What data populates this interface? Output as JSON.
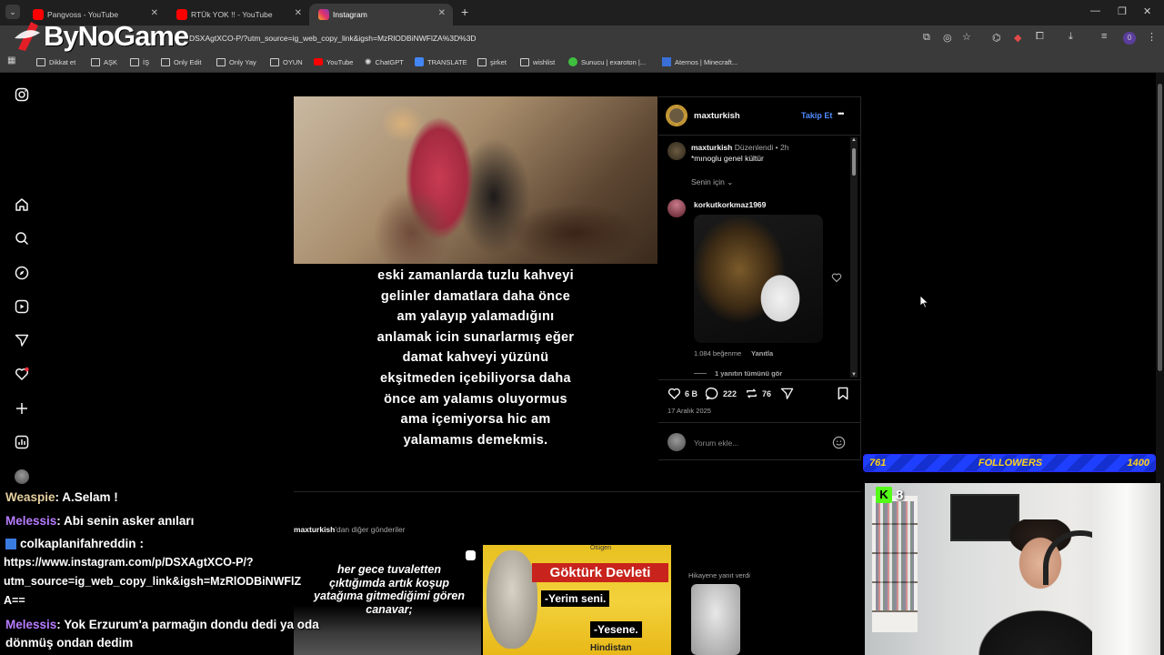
{
  "browser": {
    "tabs": [
      {
        "title": "Pangvoss - YouTube",
        "color": "#ff0000"
      },
      {
        "title": "RTÜk YOK !! - YouTube",
        "color": "#ff0000"
      },
      {
        "title": "Instagram",
        "color": "#e1306c"
      }
    ],
    "url": "DSXAgtXCO-P/?utm_source=ig_web_copy_link&igsh=MzRlODBiNWFlZA%3D%3D",
    "bookmarks": [
      "Dikkat et",
      "AŞK",
      "İŞ",
      "Only Edit",
      "Only Yay",
      "OYUN",
      "YouTube",
      "ChatGPT",
      "TRANSLATE",
      "şirket",
      "wishlist",
      "Sunucu | exaroton |...",
      "Aternos | Minecraft..."
    ],
    "profile_badge": "0"
  },
  "logo": {
    "text": "ByNoGame"
  },
  "post": {
    "caption_lines": [
      "eski zamanlarda tuzlu kahveyi",
      "gelinler damatlara daha önce",
      "am yalayıp yalamadığını",
      "anlamak icin sunarlarmış eğer",
      "damat kahveyi yüzünü",
      "ekşitmeden içebiliyorsa daha",
      "önce am yalamıs oluyormus",
      "ama içemiyorsa hic am",
      "yalamamıs demekmis."
    ],
    "author": "maxturkish",
    "follow_label": "Takip Et",
    "more_icon": "•••",
    "author_comment": {
      "user": "maxturkish",
      "edited": "Düzenlendi",
      "time": "2h",
      "text": "*mınoglu genel kültür"
    },
    "sort_label": "Senin için",
    "comment": {
      "user": "korkutkorkmaz1969",
      "likes": "1.084 beğenme",
      "reply": "Yanıtla",
      "view_replies": "1 yanıtın tümünü gör"
    },
    "stats": {
      "likes": "6 B",
      "comments": "222",
      "reposts": "76"
    },
    "date": "17 Aralık 2025",
    "comment_placeholder": "Yorum ekle..."
  },
  "more_posts": {
    "author": "maxturkish",
    "suffix": "'dan diğer gönderiler",
    "thumb1_text": "her gece tuvaletten çıktığımda artık koşup yatağıma gitmediğimi gören canavar;",
    "thumb2": {
      "title": "Göktürk Devleti",
      "line1": "-Yerim seni.",
      "line2": "-Yesene.",
      "top": "Otügen",
      "bottom": "Hindistan"
    },
    "story_reply": "Hikayene yanıt verdi"
  },
  "overlay": {
    "followers_current": "761",
    "followers_label": "FOLLOWERS",
    "followers_goal": "1400",
    "kick_count": "8"
  },
  "chat": [
    {
      "user": "Weaspie",
      "text": ": A.Selam !",
      "color": "#e4cf9f"
    },
    {
      "user": "Melessis",
      "text": ": Abi senin asker anıları",
      "color": "#b77cff"
    },
    {
      "user": "colkaplanifahreddin",
      "text": " :",
      "color": "#ffffff"
    },
    {
      "text": "https://www.instagram.com/p/DSXAgtXCO-P/?"
    },
    {
      "text": "utm_source=ig_web_copy_link&igsh=MzRlODBiNWFlZ"
    },
    {
      "text": "A=="
    },
    {
      "user": "Melessis",
      "text": ": Yok Erzurum'a parmağın dondu dedi ya oda",
      "color": "#b77cff"
    },
    {
      "text": "dönmüş ondan dedim"
    }
  ]
}
